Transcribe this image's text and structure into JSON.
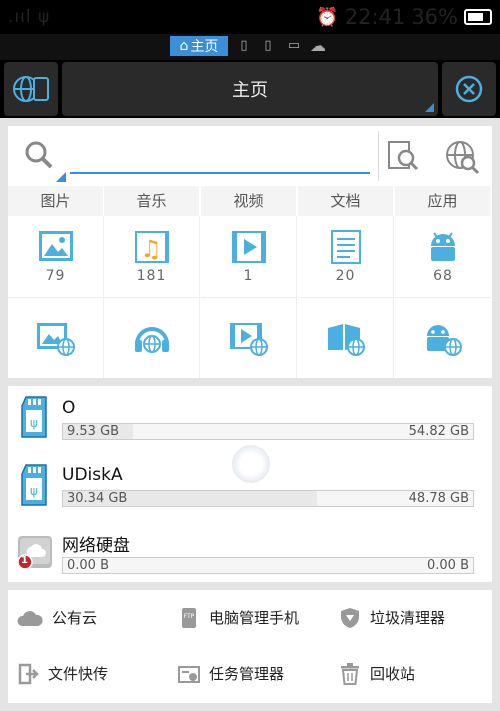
{
  "status": {
    "signal": ".ııl ψ",
    "time": "22:41",
    "battery": "36%"
  },
  "tabs": {
    "home_label": "主页"
  },
  "header": {
    "title": "主页"
  },
  "search": {
    "value": "",
    "placeholder": ""
  },
  "categories": {
    "headers": [
      "图片",
      "音乐",
      "视频",
      "文档",
      "应用"
    ],
    "counts": [
      "79",
      "181",
      "1",
      "20",
      "68"
    ]
  },
  "storage": [
    {
      "name": "O",
      "used": "9.53 GB",
      "total": "54.82 GB",
      "used_fraction": 0.17
    },
    {
      "name": "UDiskA",
      "used": "30.34 GB",
      "total": "48.78 GB",
      "used_fraction": 0.62
    },
    {
      "name": "网络硬盘",
      "used": "0.00 B",
      "total": "0.00 B",
      "used_fraction": 0,
      "badge": "1"
    }
  ],
  "tools": [
    "公有云",
    "电脑管理手机",
    "垃圾清理器",
    "文件快传",
    "任务管理器",
    "回收站"
  ],
  "colors": {
    "accent": "#3a8fd8",
    "icon_blue": "#4bb0e0"
  }
}
